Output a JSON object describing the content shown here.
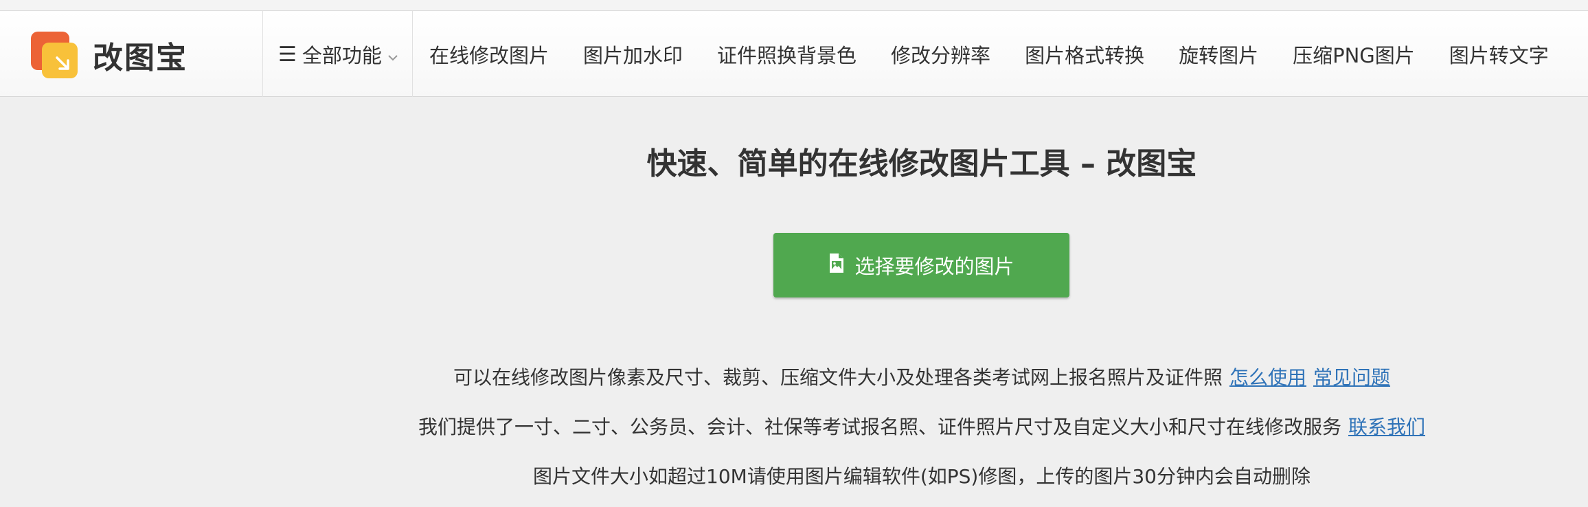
{
  "brand": {
    "name": "改图宝",
    "logo_colors": {
      "back": "#ec6336",
      "front": "#f8c13a"
    }
  },
  "nav": {
    "menu_toggle": "全部功能",
    "links": [
      "在线修改图片",
      "图片加水印",
      "证件照换背景色",
      "修改分辨率",
      "图片格式转换",
      "旋转图片",
      "压缩PNG图片",
      "图片转文字"
    ]
  },
  "main": {
    "title": "快速、简单的在线修改图片工具 – 改图宝",
    "upload_button": "选择要修改的图片",
    "line1": {
      "text": "可以在线修改图片像素及尺寸、裁剪、压缩文件大小及处理各类考试网上报名照片及证件照",
      "link1": "怎么使用",
      "link2": "常见问题"
    },
    "line2": {
      "text": "我们提供了一寸、二寸、公务员、会计、社保等考试报名照、证件照片尺寸及自定义大小和尺寸在线修改服务",
      "link": "联系我们"
    },
    "line3": {
      "text": "图片文件大小如超过10M请使用图片编辑软件(如PS)修图，上传的图片30分钟内会自动删除"
    }
  },
  "colors": {
    "accent_green": "#50a84f",
    "link_blue": "#2f73b8",
    "background": "#efefef"
  }
}
